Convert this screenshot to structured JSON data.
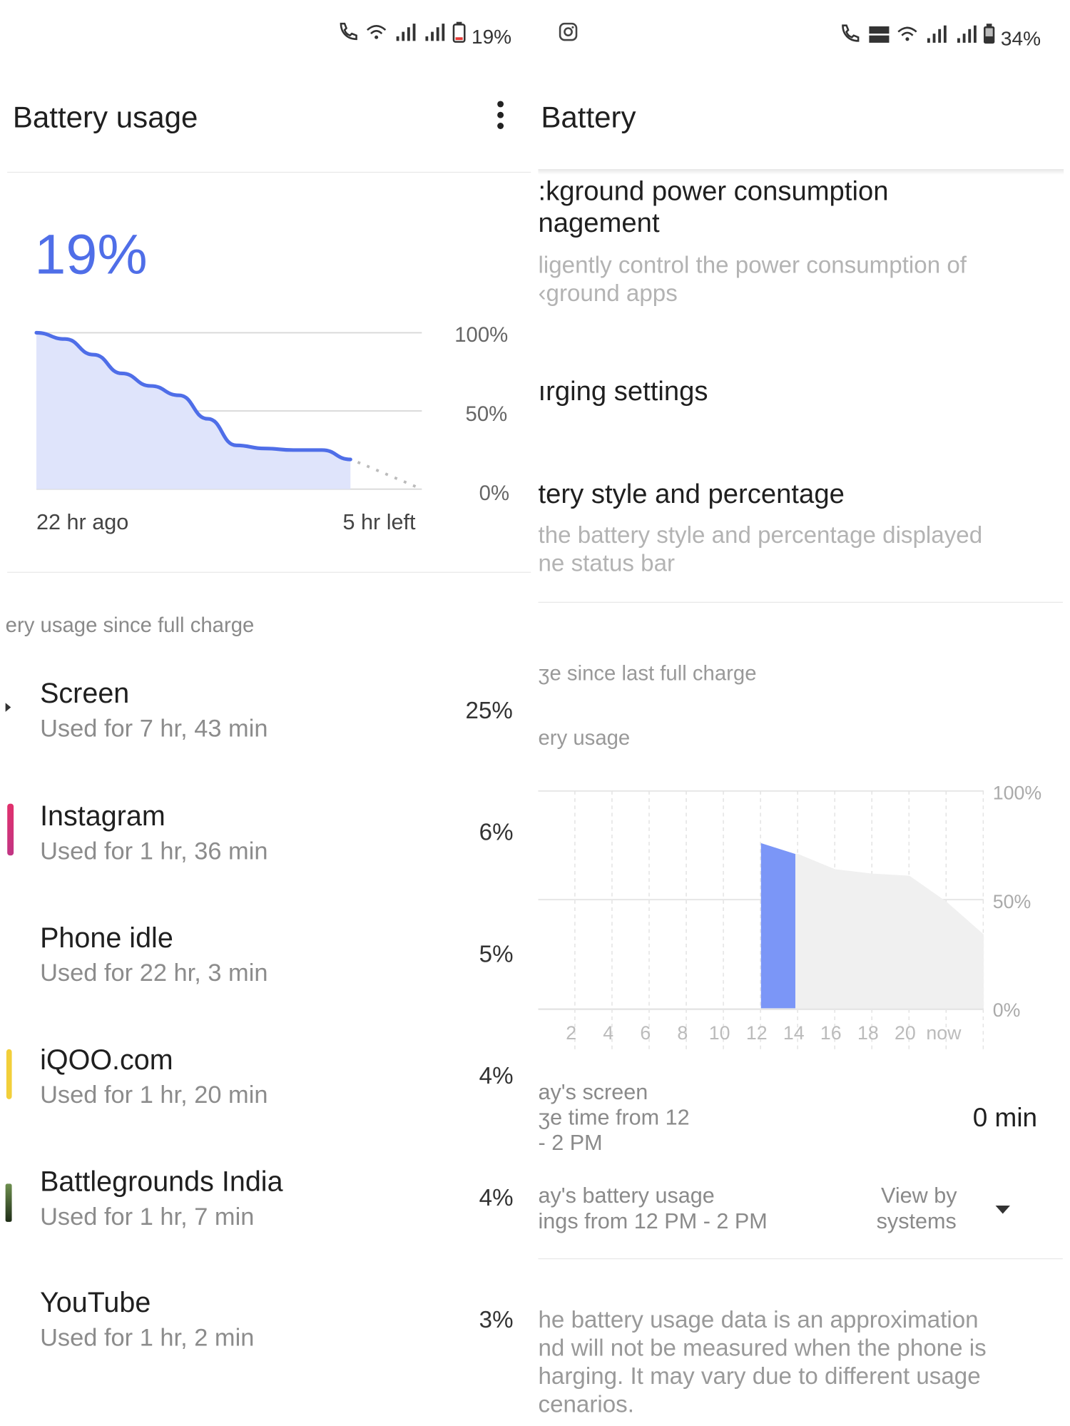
{
  "left": {
    "status": {
      "battery": "19%"
    },
    "title": "Battery usage",
    "battery_level": "19%",
    "chart_data": {
      "type": "area",
      "title": "",
      "x_start_label": "22 hr ago",
      "x_end_label": "5 hr left",
      "y_ticks": [
        "100%",
        "50%",
        "0%"
      ],
      "ylim": [
        0,
        100
      ],
      "x": [
        -22,
        -20,
        -18,
        -16,
        -14,
        -12,
        -10,
        -8,
        -6,
        -4,
        -2,
        0,
        5
      ],
      "series": [
        {
          "values": [
            100,
            96,
            86,
            74,
            66,
            60,
            45,
            28,
            26,
            25,
            25,
            19
          ]
        }
      ],
      "projection": {
        "from_percent": 19,
        "to_percent": 0,
        "style": "dotted"
      },
      "grid": true,
      "colors": {
        "line": "#4f6ee8",
        "fill": "#dfe4fb"
      }
    },
    "section_label": "ery usage since full charge",
    "apps": [
      {
        "name": "Screen",
        "usage": "Used for 7 hr, 43 min",
        "percent": "25%",
        "bar_color": "#333333"
      },
      {
        "name": "Instagram",
        "usage": "Used for 1 hr, 36 min",
        "percent": "6%",
        "bar_color": "#e1306c"
      },
      {
        "name": "Phone idle",
        "usage": "Used for 22 hr, 3 min",
        "percent": "5%",
        "bar_color": ""
      },
      {
        "name": "iQOO.com",
        "usage": "Used for 1 hr, 20 min",
        "percent": "4%",
        "bar_color": "#f2cf3a"
      },
      {
        "name": "Battlegrounds India",
        "usage": "Used for 1 hr, 7 min",
        "percent": "4%",
        "bar_color": "#3a5f2a"
      },
      {
        "name": "YouTube",
        "usage": "Used for 1 hr, 2 min",
        "percent": "3%",
        "bar_color": ""
      }
    ]
  },
  "right": {
    "status": {
      "battery": "34%"
    },
    "title": "Battery",
    "settings": [
      {
        "title_line1": ":kground power consumption",
        "title_line2": "nagement",
        "desc_line1": "ligently control the power consumption of",
        "desc_line2": "‹ground apps"
      },
      {
        "title_line1": "ırging settings"
      },
      {
        "title_line1": "tery style and percentage",
        "desc_line1": "the battery style and percentage displayed",
        "desc_line2": "ne status bar"
      }
    ],
    "since_label": "ʒe since last full charge",
    "usage_label": "ery usage",
    "chart_data": {
      "type": "bar",
      "x_ticks": [
        "2",
        "4",
        "6",
        "8",
        "10",
        "12",
        "14",
        "16",
        "18",
        "20",
        "now"
      ],
      "y_ticks": [
        "100%",
        "50%",
        "0%"
      ],
      "ylim": [
        0,
        100
      ],
      "highlight": {
        "x": "12",
        "start": 76,
        "end": 71
      },
      "projection": {
        "x": [
          14,
          16,
          18,
          20,
          22,
          24
        ],
        "values": [
          71,
          64,
          62,
          61,
          49,
          34
        ]
      },
      "colors": {
        "highlight": "#7b96f7",
        "projection": "#f0f0f0"
      },
      "grid": true
    },
    "screen_time": {
      "line1": "ay's screen",
      "line2": "ʒe time from 12",
      "line3": "- 2 PM",
      "value": "0 min"
    },
    "battery_usage": {
      "line1": "ay's battery usage",
      "line2": "ings from 12 PM - 2 PM",
      "view_by1": "View by",
      "view_by2": "systems"
    },
    "footer": [
      "he battery usage data is an approximation",
      "nd will not be measured when the phone is",
      "harging. It may vary due to different usage",
      "cenarios."
    ]
  }
}
